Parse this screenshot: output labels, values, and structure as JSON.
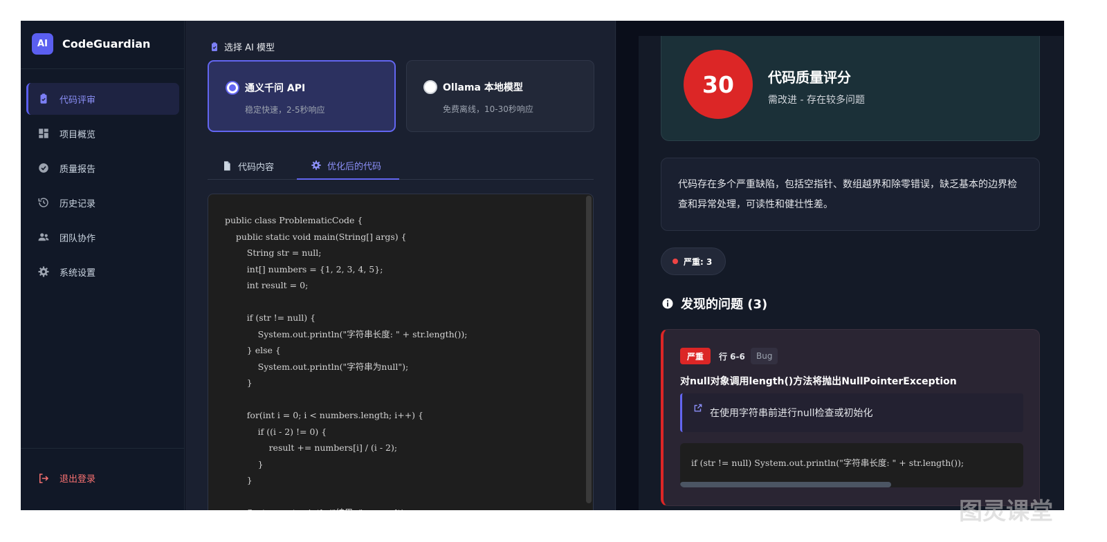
{
  "app": {
    "logo": "AI",
    "name": "CodeGuardian"
  },
  "sidebar": {
    "items": [
      {
        "label": "代码评审",
        "icon": "clipboard-check-icon",
        "active": true
      },
      {
        "label": "项目概览",
        "icon": "dashboard-icon",
        "active": false
      },
      {
        "label": "质量报告",
        "icon": "check-circle-icon",
        "active": false
      },
      {
        "label": "历史记录",
        "icon": "history-icon",
        "active": false
      },
      {
        "label": "团队协作",
        "icon": "users-icon",
        "active": false
      },
      {
        "label": "系统设置",
        "icon": "gear-icon",
        "active": false
      }
    ],
    "logout_label": "退出登录"
  },
  "model_select": {
    "title": "选择 AI 模型",
    "options": [
      {
        "name": "通义千问 API",
        "desc": "稳定快速，2-5秒响应",
        "selected": true
      },
      {
        "name": "Ollama 本地模型",
        "desc": "免费离线，10-30秒响应",
        "selected": false
      }
    ]
  },
  "tabs": [
    {
      "label": "代码内容",
      "icon": "file-icon",
      "active": false
    },
    {
      "label": "优化后的代码",
      "icon": "gear-icon",
      "active": true
    }
  ],
  "code": "public class ProblematicCode {\n    public static void main(String[] args) {\n        String str = null;\n        int[] numbers = {1, 2, 3, 4, 5};\n        int result = 0;\n\n        if (str != null) {\n            System.out.println(\"字符串长度: \" + str.length());\n        } else {\n            System.out.println(\"字符串为null\");\n        }\n\n        for(int i = 0; i < numbers.length; i++) {\n            if ((i - 2) != 0) {\n                result += numbers[i] / (i - 2);\n            }\n        }\n\n        System.out.println(\"结果: \" + result);",
  "score": {
    "value": "30",
    "title": "代码质量评分",
    "subtitle": "需改进 - 存在较多问题",
    "color": "#dc2626"
  },
  "summary": "代码存在多个严重缺陷，包括空指针、数组越界和除零错误，缺乏基本的边界检查和异常处理，可读性和健壮性差。",
  "severity_pill": "严重: 3",
  "issues_heading": "发现的问题 (3)",
  "issue": {
    "severity": "严重",
    "line": "行 6-6",
    "type": "Bug",
    "title": "对null对象调用length()方法将抛出NullPointerException",
    "suggestion": "在使用字符串前进行null检查或初始化",
    "fix_code": "if (str != null) System.out.println(\"字符串长度: \" + str.length());"
  },
  "watermark": "图灵课堂",
  "colors": {
    "accent": "#6366f1",
    "danger": "#dc2626",
    "background": "#0d1220"
  }
}
